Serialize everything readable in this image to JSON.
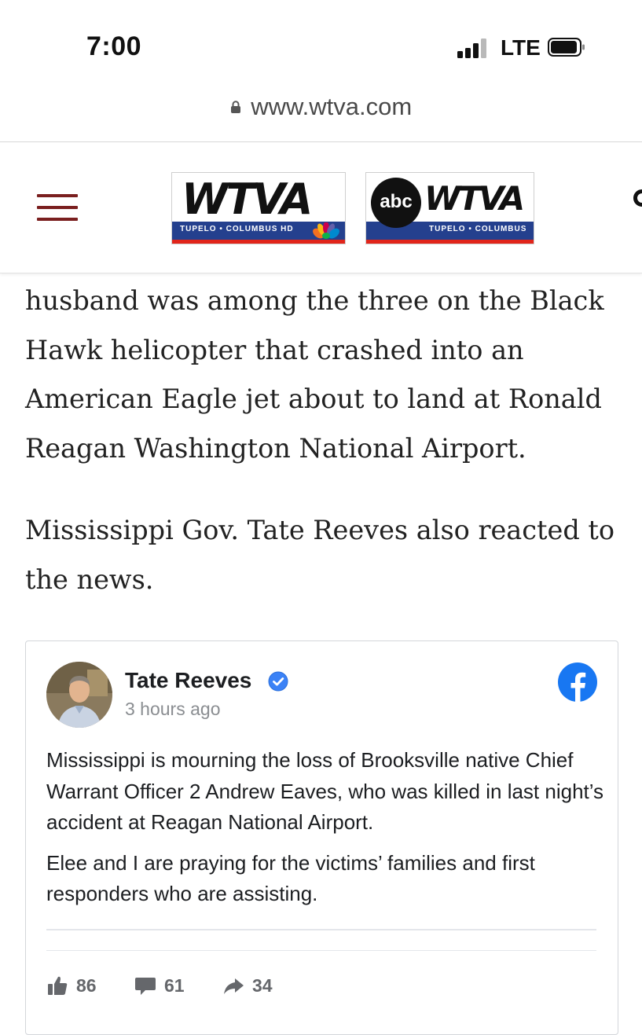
{
  "status_bar": {
    "time": "7:00",
    "network": "LTE"
  },
  "browser": {
    "url": "www.wtva.com"
  },
  "site": {
    "logo1": {
      "wordmark": "WTVA",
      "subtitle": "TUPELO • COLUMBUS HD"
    },
    "logo2": {
      "network": "abc",
      "wordmark": "WTVA",
      "subtitle": "TUPELO • COLUMBUS"
    }
  },
  "article": {
    "paragraphs": [
      "husband was among the three on the Black Hawk helicopter that crashed into an American Eagle jet about to land at Ronald Reagan Washington National Airport.",
      "Mississippi Gov. Tate Reeves also reacted to the news."
    ]
  },
  "facebook_post": {
    "author": "Tate Reeves",
    "time": "3 hours ago",
    "paragraphs": [
      "Mississippi is mourning the loss of Brooksville native Chief Warrant Officer 2 Andrew Eaves, who was killed in last night’s accident at Reagan National Airport.",
      "Elee and I are praying for the victims’ families and first responders who are assisting."
    ],
    "likes": "86",
    "comments": "61",
    "shares": "34"
  },
  "icons": {
    "menu": "hamburger-menu-icon",
    "lock": "lock-icon",
    "search": "search-icon",
    "verified": "verified-badge-icon",
    "facebook": "facebook-logo-icon",
    "like": "thumbs-up-icon",
    "comment": "comment-icon",
    "share": "share-arrow-icon"
  },
  "colors": {
    "menu_accent": "#7a1f1f",
    "logo_strip": "#24408e",
    "logo_stripe": "#e1251b",
    "facebook_blue": "#1877f2"
  }
}
